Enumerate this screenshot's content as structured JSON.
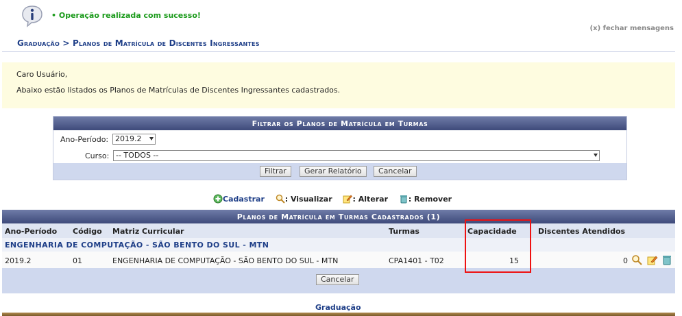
{
  "message": {
    "text": "• Operação realizada com sucesso!",
    "close": "(x) fechar mensagens"
  },
  "breadcrumb": "Graduação > Planos de Matrícula de Discentes Ingressantes",
  "info": {
    "line1": "Caro Usuário,",
    "line2": "Abaixo estão listados os Planos de Matrículas de Discentes Ingressantes cadastrados."
  },
  "filter": {
    "caption": "Filtrar os Planos de Matrícula em Turmas",
    "ano_label": "Ano-Período:",
    "ano_value": "2019.2",
    "curso_label": "Curso:",
    "curso_value": "-- TODOS --",
    "btn_filtrar": "Filtrar",
    "btn_relatorio": "Gerar Relatório",
    "btn_cancelar": "Cancelar"
  },
  "legend": {
    "cadastrar": "Cadastrar",
    "visualizar": ": Visualizar",
    "alterar": ": Alterar",
    "remover": ": Remover"
  },
  "table": {
    "caption": "Planos de Matrícula em Turmas Cadastrados (1)",
    "headers": [
      "Ano-Período",
      "Código",
      "Matriz Curricular",
      "Turmas",
      "Capacidade",
      "Discentes Atendidos"
    ],
    "group": "ENGENHARIA DE COMPUTAÇÃO - SÃO BENTO DO SUL - MTN",
    "rows": [
      {
        "ano": "2019.2",
        "codigo": "01",
        "matriz": "ENGENHARIA DE COMPUTAÇÃO - SÃO BENTO DO SUL - MTN",
        "turmas": "CPA1401 - T02",
        "capacidade": "15",
        "discentes": "0"
      }
    ],
    "btn_cancelar": "Cancelar"
  },
  "footer": {
    "link": "Graduação"
  },
  "colors": {
    "header_blue": "#3e4a7a",
    "link_blue": "#1f3f88",
    "success_green": "#1a9a1a",
    "highlight_red": "#ee1111",
    "info_bg": "#fefce0"
  }
}
